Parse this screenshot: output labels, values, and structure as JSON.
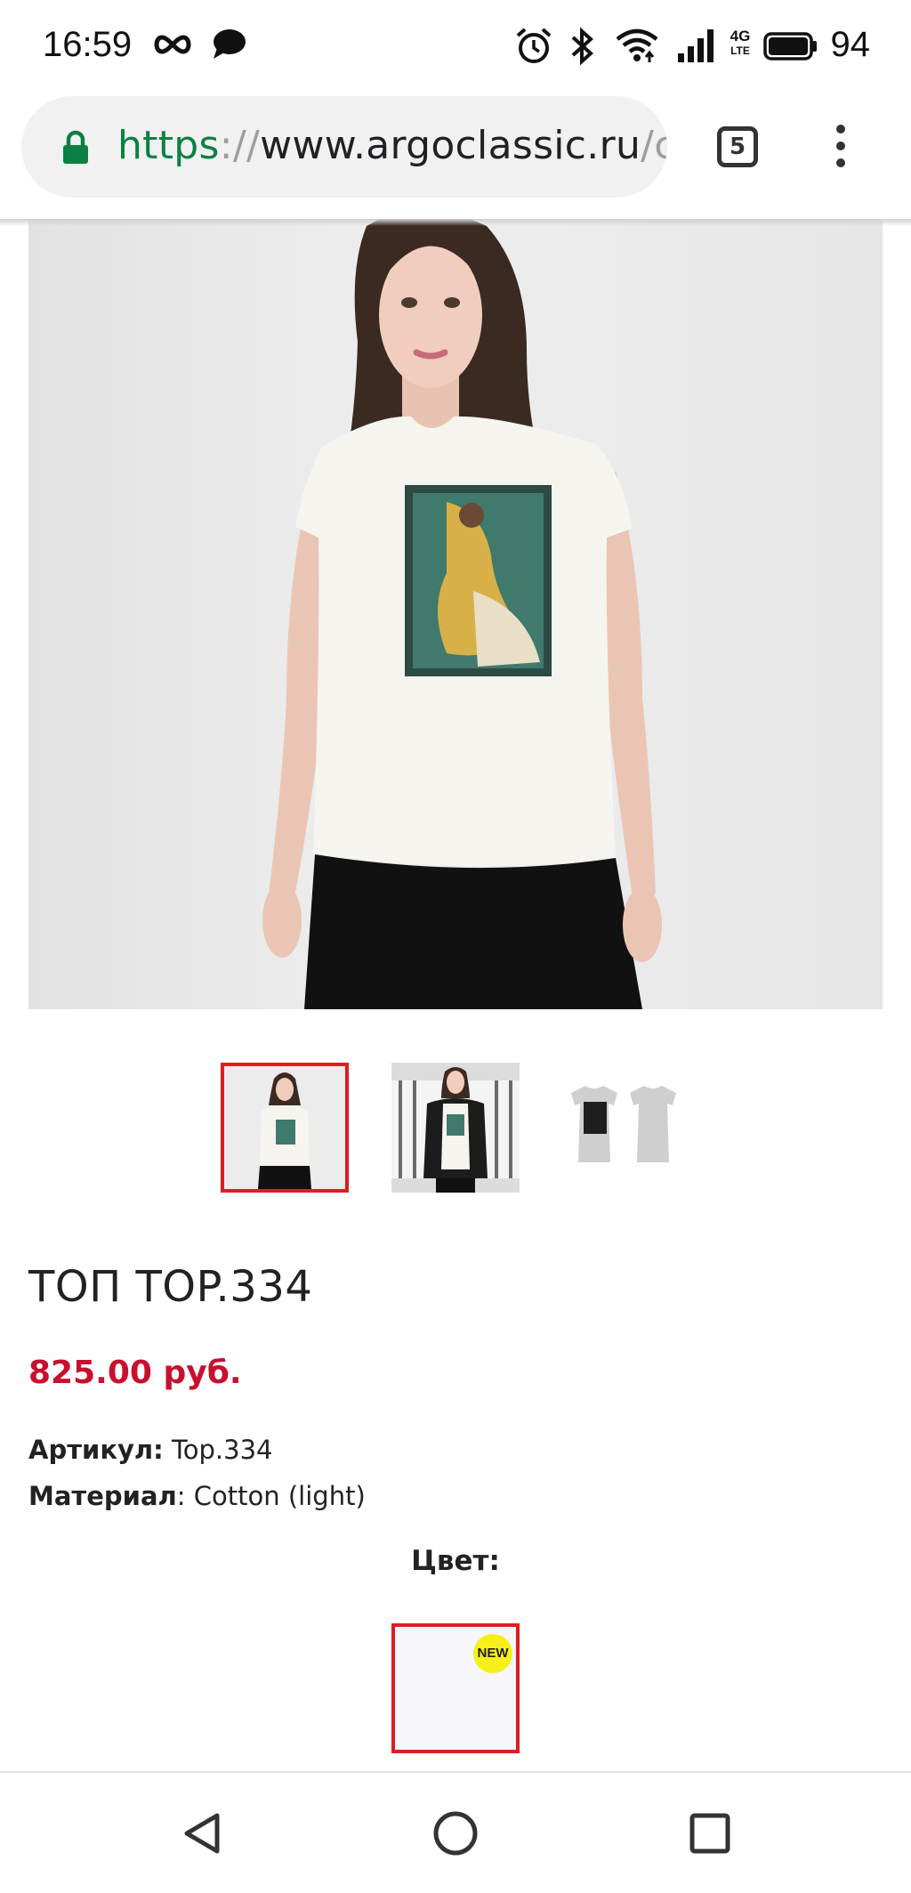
{
  "status_bar": {
    "time": "16:59",
    "left_icons": [
      "infinity-icon",
      "chat-bubble-icon"
    ],
    "right_icons": [
      "alarm-icon",
      "bluetooth-icon",
      "wifi-icon",
      "signal-icon",
      "4g-lte-icon",
      "battery-icon"
    ],
    "network_label_top": "4G",
    "network_label_bottom": "LTE",
    "battery": "94"
  },
  "browser": {
    "url_scheme": "https",
    "url_separator": "://",
    "url_host": "www.argoclassic.ru",
    "url_rest": "/c",
    "tab_count": "5"
  },
  "product": {
    "thumbnails": [
      {
        "name": "thumb-front-view",
        "active": true
      },
      {
        "name": "thumb-jacket-view",
        "active": false
      },
      {
        "name": "thumb-flat-view",
        "active": false
      }
    ],
    "title": "ТОП TOP.334",
    "price": "825.00 руб.",
    "article_label": "Артикул:",
    "article_value": " Top.334",
    "material_label": "Материал",
    "material_value": ": Cotton (light)",
    "color_heading": "Цвет:",
    "swatch_badge": "NEW"
  },
  "colors": {
    "accent_red": "#e11b22",
    "price_red": "#c8102e",
    "badge_yellow": "#f6ef1a",
    "url_green": "#0b8043"
  },
  "nav_bar": {
    "buttons": [
      "back-icon",
      "home-icon",
      "recents-icon"
    ]
  }
}
